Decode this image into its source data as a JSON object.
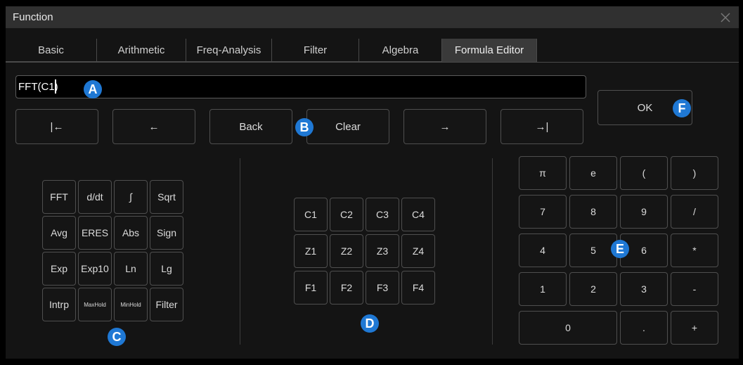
{
  "window": {
    "title": "Function"
  },
  "tabs": [
    "Basic",
    "Arithmetic",
    "Freq-Analysis",
    "Filter",
    "Algebra",
    "Formula Editor"
  ],
  "active_tab": "Formula Editor",
  "formula": {
    "value": "FFT(C1)"
  },
  "nav_buttons": [
    "|←",
    "←",
    "Back",
    "Clear",
    "→",
    "→|"
  ],
  "ok_label": "OK",
  "functions": [
    "FFT",
    "d/dt",
    "∫",
    "Sqrt",
    "Avg",
    "ERES",
    "Abs",
    "Sign",
    "Exp",
    "Exp10",
    "Ln",
    "Lg",
    "Intrp",
    "MaxHold",
    "MinHold",
    "Filter"
  ],
  "sources": [
    "C1",
    "C2",
    "C3",
    "C4",
    "Z1",
    "Z2",
    "Z3",
    "Z4",
    "F1",
    "F2",
    "F3",
    "F4"
  ],
  "keypad": [
    "π",
    "e",
    "(",
    ")",
    "7",
    "8",
    "9",
    "/",
    "4",
    "5",
    "6",
    "*",
    "1",
    "2",
    "3",
    "-",
    "0",
    ".",
    "+"
  ],
  "callouts": [
    "A",
    "B",
    "C",
    "D",
    "E",
    "F"
  ],
  "colors": {
    "accent": "#1f78d4",
    "background": "#141414",
    "border": "#4f4f4f"
  }
}
